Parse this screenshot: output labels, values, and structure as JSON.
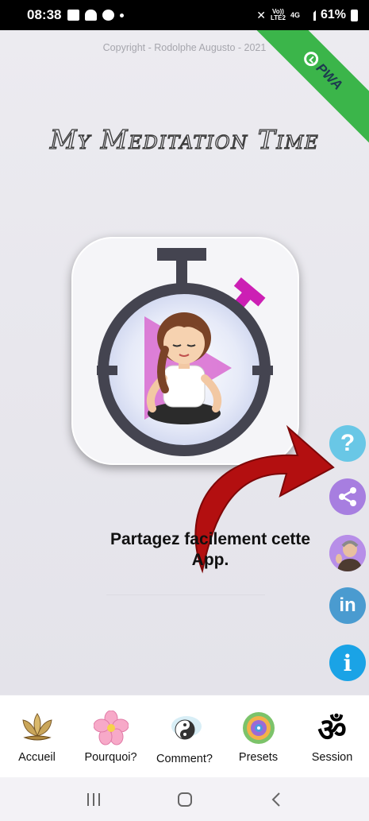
{
  "status_bar": {
    "time": "08:38",
    "network_top": "Vo))",
    "network_bottom": "LTE2",
    "network_gen": "4G",
    "battery": "61%"
  },
  "copyright": "Copyright - Rodolphe Augusto - 2021",
  "pwa_badge": {
    "label": "PWA",
    "color": "#3bb54a"
  },
  "app_title": "My Meditation Time",
  "share_message": "Partagez facilement cette App.",
  "side_buttons": {
    "help": {
      "glyph": "?",
      "icon": "question-icon"
    },
    "share": {
      "icon": "share-icon"
    },
    "author": {
      "icon": "avatar-icon"
    },
    "linkedin": {
      "glyph": "in",
      "icon": "linkedin-icon"
    },
    "info": {
      "glyph": "i",
      "icon": "info-icon"
    }
  },
  "bottom_nav": {
    "items": [
      {
        "label": "Accueil",
        "icon": "lotus-icon"
      },
      {
        "label": "Pourquoi?",
        "icon": "flower-icon"
      },
      {
        "label": "Comment?",
        "icon": "yin-yang-icon"
      },
      {
        "label": "Presets",
        "icon": "mandala-icon"
      },
      {
        "label": "Session",
        "icon": "om-icon"
      }
    ]
  },
  "system_nav": {
    "recent": "recent-apps-icon",
    "home": "home-icon",
    "back": "back-icon"
  },
  "colors": {
    "accent_magenta": "#cc1fb4",
    "arrow_red": "#b30f10",
    "share_purple": "#a77ee0"
  }
}
